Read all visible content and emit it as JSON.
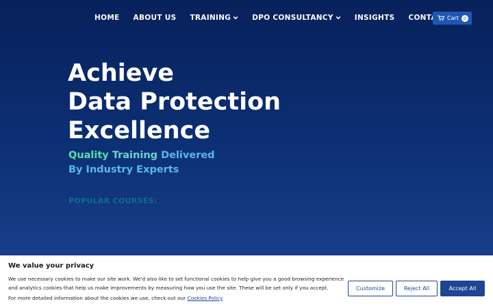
{
  "nav": {
    "items": [
      {
        "label": "HOME",
        "dropdown": false
      },
      {
        "label": "ABOUT US",
        "dropdown": false
      },
      {
        "label": "TRAINING",
        "dropdown": true
      },
      {
        "label": "DPO CONSULTANCY",
        "dropdown": true
      },
      {
        "label": "INSIGHTS",
        "dropdown": false
      },
      {
        "label": "CONTACT US",
        "dropdown": false
      }
    ],
    "cart": {
      "label": "Cart",
      "count": "0",
      "icon": "cart-icon"
    }
  },
  "hero": {
    "title_lines": [
      "Achieve",
      "Data Protection",
      "Excellence"
    ],
    "subtitle": {
      "line1_a": "Quality",
      "line1_b": "Training",
      "line1_c": "Delivered",
      "line2": "By Industry Experts"
    },
    "popular_label": "POPULAR COURSES:"
  },
  "cookie": {
    "title": "We value your privacy",
    "text": "We use necessary cookies to make our site work. We'd also like to set functional cookies to help give you a good browsing experience and analytics cookies that help us make improvements by measuring how you use the site. These will be set only if you accept.",
    "more_text": "For more detailed information about the cookies we use, check out our",
    "more_link": "Cookies Policy",
    "buttons": {
      "customize": "Customize",
      "reject": "Reject All",
      "accept": "Accept All"
    }
  },
  "colors": {
    "primary": "#1c4593",
    "background_top": "#07215b",
    "accent_green": "#4ee6a4",
    "accent_blue": "#59b8e8"
  }
}
